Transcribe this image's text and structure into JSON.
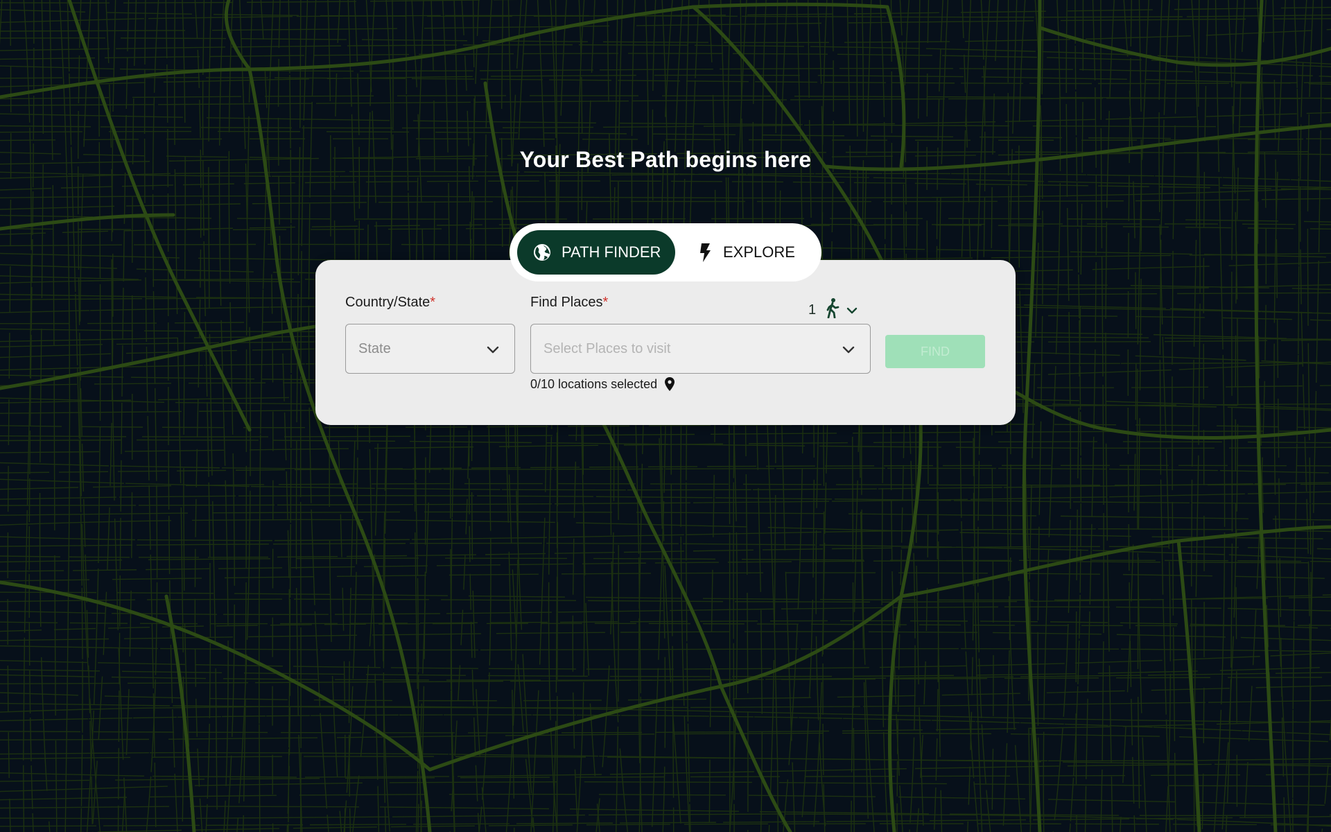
{
  "page": {
    "title": "Your Best Path begins here"
  },
  "mode_switch": {
    "tabs": [
      {
        "label": "PATH FINDER",
        "icon": "globe-icon",
        "active": true
      },
      {
        "label": "EXPLORE",
        "icon": "lightning-bolt-icon",
        "active": false
      }
    ]
  },
  "form": {
    "country_state": {
      "label": "Country/State",
      "required_mark": "*",
      "placeholder": "State"
    },
    "find_places": {
      "label": "Find Places",
      "required_mark": "*",
      "placeholder": "Select Places to visit"
    },
    "travelers": {
      "count": "1",
      "icon": "walking-person-icon"
    },
    "locations_status": "0/10 locations selected",
    "find_button": "FIND"
  },
  "colors": {
    "background": "#07101a",
    "road_network": "#2c4a14",
    "active_tab": "#0b3a2a",
    "find_button_disabled": "#9fe0b8",
    "required_mark": "#d0342c"
  }
}
